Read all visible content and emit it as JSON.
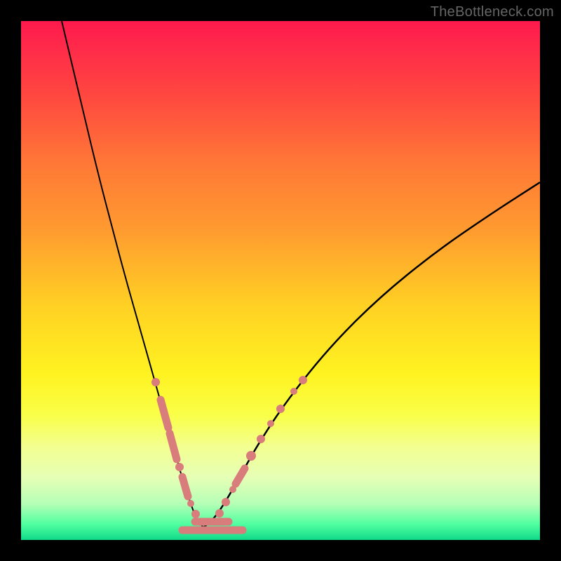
{
  "watermark": "TheBottleneck.com",
  "chart_data": {
    "type": "line",
    "title": "",
    "xlabel": "",
    "ylabel": "",
    "xlim": [
      30,
      770
    ],
    "ylim": [
      30,
      770
    ],
    "background_gradient": {
      "stops": [
        {
          "offset": 0.0,
          "color": "#ff1a4d"
        },
        {
          "offset": 0.05,
          "color": "#ff2a4a"
        },
        {
          "offset": 0.14,
          "color": "#ff4640"
        },
        {
          "offset": 0.28,
          "color": "#ff7a36"
        },
        {
          "offset": 0.4,
          "color": "#ff9a30"
        },
        {
          "offset": 0.55,
          "color": "#ffd123"
        },
        {
          "offset": 0.68,
          "color": "#fff321"
        },
        {
          "offset": 0.76,
          "color": "#f9ff48"
        },
        {
          "offset": 0.82,
          "color": "#f3ff90"
        },
        {
          "offset": 0.88,
          "color": "#e6ffb6"
        },
        {
          "offset": 0.93,
          "color": "#b6ffb6"
        },
        {
          "offset": 0.97,
          "color": "#4fffa0"
        },
        {
          "offset": 1.0,
          "color": "#10d98a"
        }
      ]
    },
    "series": [
      {
        "name": "left-curve",
        "x": [
          88,
          100,
          120,
          140,
          160,
          180,
          200,
          220,
          235,
          250,
          262,
          272,
          278,
          284,
          290
        ],
        "y": [
          30,
          80,
          165,
          248,
          325,
          400,
          470,
          541,
          594,
          646,
          690,
          718,
          735,
          745,
          752
        ]
      },
      {
        "name": "right-curve",
        "x": [
          290,
          300,
          312,
          326,
          344,
          370,
          410,
          470,
          540,
          620,
          700,
          770
        ],
        "y": [
          752,
          745,
          730,
          708,
          676,
          630,
          570,
          495,
          425,
          360,
          305,
          260
        ]
      }
    ],
    "floor_segments": [
      {
        "name": "floor-1",
        "x1": 260,
        "y1": 756,
        "x2": 346,
        "y2": 756
      },
      {
        "name": "floor-2",
        "x1": 278,
        "y1": 744,
        "x2": 326,
        "y2": 744
      }
    ],
    "markers": [
      {
        "name": "left-dot-1",
        "x": 222,
        "y": 545,
        "r": 6
      },
      {
        "name": "left-dash-1",
        "x1": 229,
        "y1": 570,
        "x2": 240,
        "y2": 610
      },
      {
        "name": "left-dash-2",
        "x1": 242,
        "y1": 618,
        "x2": 252,
        "y2": 655
      },
      {
        "name": "left-dot-2",
        "x": 256,
        "y": 666,
        "r": 6
      },
      {
        "name": "left-dash-3",
        "x1": 260,
        "y1": 680,
        "x2": 268,
        "y2": 708
      },
      {
        "name": "left-dot-3",
        "x": 272,
        "y": 718,
        "r": 5
      },
      {
        "name": "left-dot-4",
        "x": 279,
        "y": 733,
        "r": 6
      },
      {
        "name": "left-dot-5",
        "x": 286,
        "y": 745,
        "r": 5
      },
      {
        "name": "right-dot-1",
        "x": 313,
        "y": 732,
        "r": 6
      },
      {
        "name": "right-dot-2",
        "x": 322,
        "y": 716,
        "r": 6
      },
      {
        "name": "right-dot-3",
        "x": 332,
        "y": 698,
        "r": 5
      },
      {
        "name": "right-dash-1",
        "x1": 336,
        "y1": 690,
        "x2": 349,
        "y2": 668
      },
      {
        "name": "right-dot-4",
        "x": 358,
        "y": 650,
        "r": 7
      },
      {
        "name": "right-dot-5",
        "x": 372,
        "y": 626,
        "r": 6
      },
      {
        "name": "right-dot-6",
        "x": 386,
        "y": 604,
        "r": 5
      },
      {
        "name": "right-dot-7",
        "x": 400,
        "y": 583,
        "r": 6
      },
      {
        "name": "right-dot-8",
        "x": 419,
        "y": 558,
        "r": 5
      },
      {
        "name": "right-dot-9",
        "x": 432,
        "y": 542,
        "r": 6
      }
    ]
  }
}
